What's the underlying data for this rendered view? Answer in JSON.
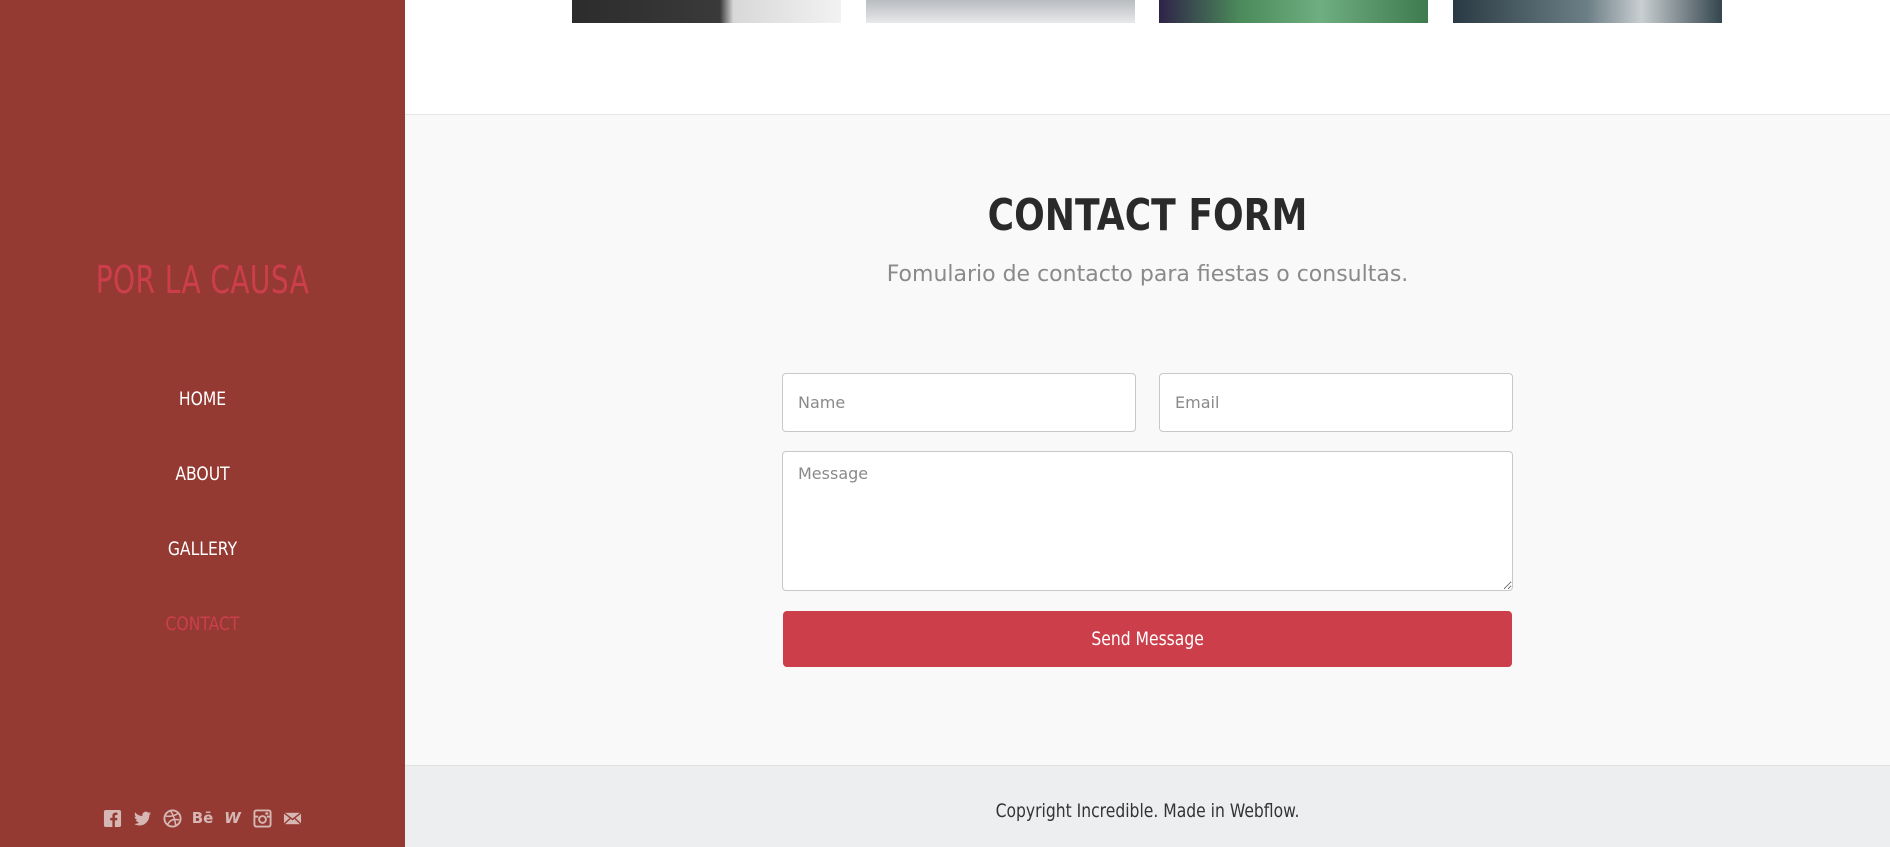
{
  "sidebar": {
    "brand": "POR LA CAUSA",
    "nav": [
      {
        "label": "HOME"
      },
      {
        "label": "ABOUT"
      },
      {
        "label": "GALLERY"
      },
      {
        "label": "CONTACT",
        "active": true
      }
    ],
    "social_icons": [
      "facebook-icon",
      "twitter-icon",
      "dribbble-icon",
      "behance-icon",
      "webflow-icon",
      "instagram-icon",
      "email-icon"
    ],
    "behance_text": "Bē",
    "webflow_text": "W"
  },
  "gallery": {
    "thumbnails": [
      "gallery-thumb-1",
      "gallery-thumb-2",
      "gallery-thumb-3",
      "gallery-thumb-4"
    ]
  },
  "contact": {
    "title": "CONTACT FORM",
    "subtitle": "Fomulario de contacto para fiestas o consultas.",
    "name_placeholder": "Name",
    "email_placeholder": "Email",
    "message_placeholder": "Message",
    "send_label": "Send Message"
  },
  "footer": {
    "text": "Copyright Incredible. Made in Webflow."
  },
  "colors": {
    "sidebar_bg": "#943a33",
    "accent": "#cc3f4a",
    "contact_bg": "#f9f9f9",
    "footer_bg": "#edeef0"
  }
}
